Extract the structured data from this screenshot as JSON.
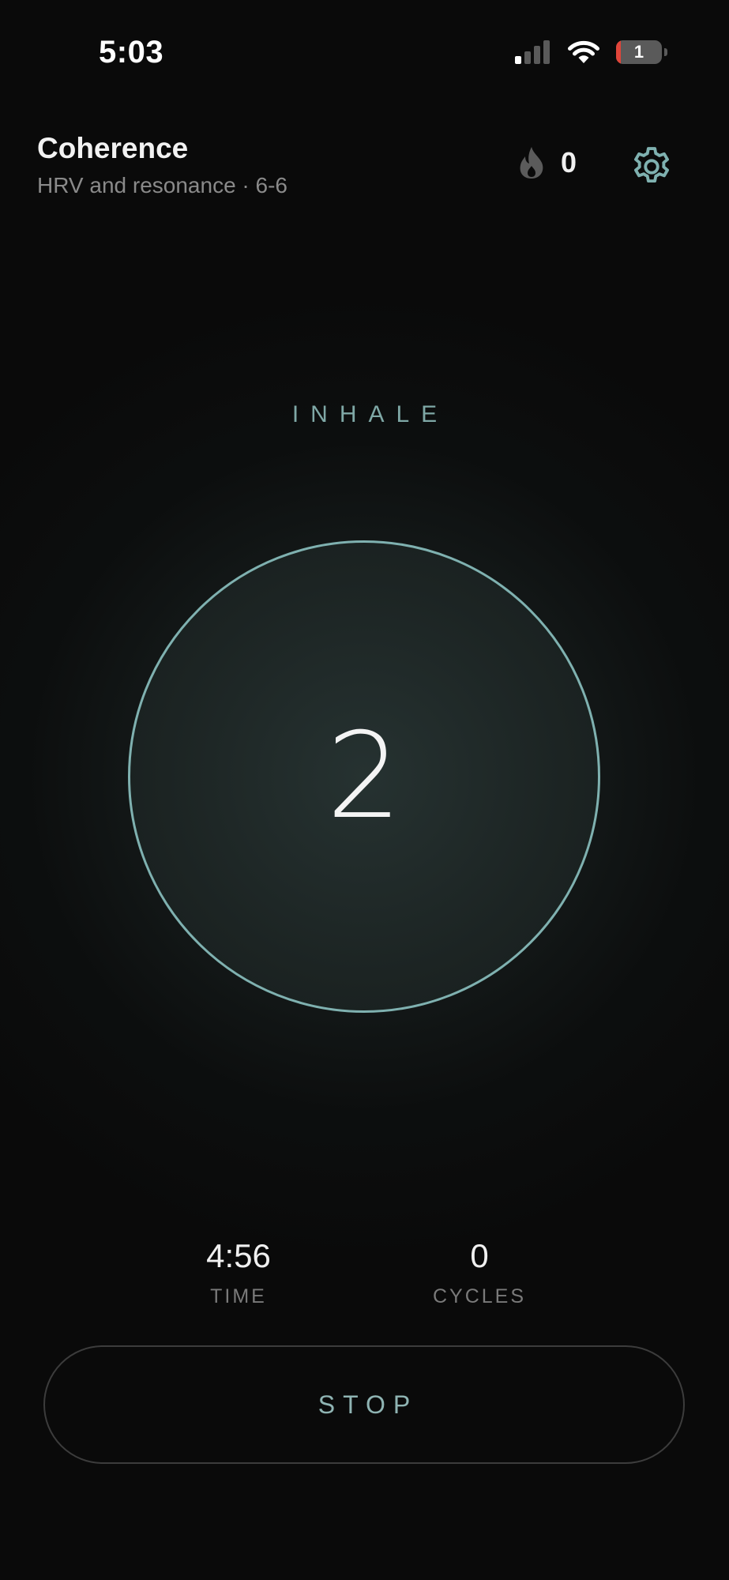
{
  "status_bar": {
    "time": "5:03",
    "battery_level": "1",
    "icons": [
      "cellular-signal-icon",
      "wifi-icon",
      "battery-icon"
    ]
  },
  "header": {
    "title": "Coherence",
    "subtitle": "HRV and resonance · 6-6",
    "streak_count": "0",
    "icons": [
      "flame-icon",
      "gear-icon"
    ]
  },
  "session": {
    "phase": "INHALE",
    "count": "2"
  },
  "stats": {
    "time_value": "4:56",
    "time_label": "TIME",
    "cycles_value": "0",
    "cycles_label": "CYCLES"
  },
  "controls": {
    "stop_label": "STOP"
  },
  "colors": {
    "background": "#0a0a0a",
    "accent": "#7fb1b0",
    "muted_text": "#8a8a8a"
  }
}
